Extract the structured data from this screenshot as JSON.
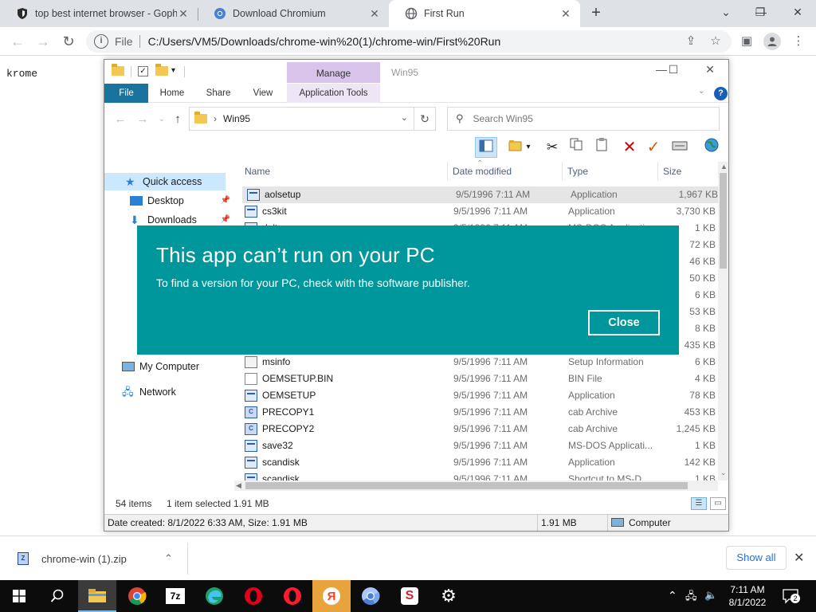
{
  "browser": {
    "tabs": [
      {
        "title": "top best internet browser - Gopher",
        "active": false
      },
      {
        "title": "Download Chromium",
        "active": false
      },
      {
        "title": "First Run",
        "active": true
      }
    ],
    "omnibox": {
      "scheme": "File",
      "url": "C:/Users/VM5/Downloads/chrome-win%20(1)/chrome-win/First%20Run"
    }
  },
  "page": {
    "text": "krome"
  },
  "explorer": {
    "window_title": "Win95",
    "contextual_tab_group": "Manage",
    "ribbon_tabs": [
      "File",
      "Home",
      "Share",
      "View",
      "Application Tools"
    ],
    "address": {
      "current": "Win95"
    },
    "search": {
      "placeholder": "Search Win95"
    },
    "nav_items": {
      "quick_access": "Quick access",
      "desktop": "Desktop",
      "downloads": "Downloads",
      "my_computer": "My Computer",
      "network": "Network"
    },
    "columns": {
      "name": "Name",
      "date": "Date modified",
      "type": "Type",
      "size": "Size"
    },
    "files": [
      {
        "name": "aolsetup",
        "date": "9/5/1996 7:11 AM",
        "type": "Application",
        "size": "1,967 KB",
        "icon": "app-icon",
        "selected": true
      },
      {
        "name": "cs3kit",
        "date": "9/5/1996 7:11 AM",
        "type": "Application",
        "size": "3,730 KB",
        "icon": "app-icon"
      },
      {
        "name": "deltree",
        "date": "9/5/1996 7:11 AM",
        "type": "MS-DOS Application",
        "size": "1 KB",
        "icon": "app-icon"
      },
      {
        "name": "",
        "date": "",
        "type": "",
        "size": "72 KB",
        "icon": ""
      },
      {
        "name": "",
        "date": "",
        "type": "",
        "size": "46 KB",
        "icon": ""
      },
      {
        "name": "",
        "date": "",
        "type": "",
        "size": "50 KB",
        "icon": ""
      },
      {
        "name": "",
        "date": "",
        "type": "",
        "size": "6 KB",
        "icon": ""
      },
      {
        "name": "",
        "date": "",
        "type": "",
        "size": "53 KB",
        "icon": ""
      },
      {
        "name": "",
        "date": "",
        "type": "",
        "size": "8 KB",
        "icon": ""
      },
      {
        "name": "",
        "date": "",
        "type": "",
        "size": "435 KB",
        "icon": ""
      },
      {
        "name": "msinfo",
        "date": "9/5/1996 7:11 AM",
        "type": "Setup Information",
        "size": "6 KB",
        "icon": "info-icon"
      },
      {
        "name": "OEMSETUP.BIN",
        "date": "9/5/1996 7:11 AM",
        "type": "BIN File",
        "size": "4 KB",
        "icon": "doc-icon"
      },
      {
        "name": "OEMSETUP",
        "date": "9/5/1996 7:11 AM",
        "type": "Application",
        "size": "78 KB",
        "icon": "app-icon"
      },
      {
        "name": "PRECOPY1",
        "date": "9/5/1996 7:11 AM",
        "type": "cab Archive",
        "size": "453 KB",
        "icon": "cab-icon"
      },
      {
        "name": "PRECOPY2",
        "date": "9/5/1996 7:11 AM",
        "type": "cab Archive",
        "size": "1,245 KB",
        "icon": "cab-icon"
      },
      {
        "name": "save32",
        "date": "9/5/1996 7:11 AM",
        "type": "MS-DOS Applicati...",
        "size": "1 KB",
        "icon": "app-icon"
      },
      {
        "name": "scandisk",
        "date": "9/5/1996 7:11 AM",
        "type": "Application",
        "size": "142 KB",
        "icon": "app-icon"
      },
      {
        "name": "scandisk",
        "date": "9/5/1996 7:11 AM",
        "type": "Shortcut to MS-D...",
        "size": "1 KB",
        "icon": "app-icon"
      }
    ],
    "status": {
      "count": "54 items",
      "selection": "1 item selected",
      "size": "1.91 MB"
    },
    "w95status": {
      "info": "Date created: 8/1/2022 6:33 AM, Size: 1.91 MB",
      "size": "1.91 MB",
      "location": "Computer"
    }
  },
  "dialog": {
    "title": "This app can’t run on your PC",
    "message": "To find a version for your PC, check with the software publisher.",
    "close_label": "Close"
  },
  "download_shelf": {
    "file": "chrome-win (1).zip",
    "show_all": "Show all"
  },
  "taskbar": {
    "apps": [
      "file-explorer",
      "chrome",
      "7zip",
      "edge",
      "opera",
      "opera-gx",
      "yandex",
      "chromium",
      "app-s",
      "settings"
    ],
    "time": "7:11 AM",
    "date": "8/1/2022",
    "notifications": "2"
  },
  "colors": {
    "dialog_bg": "#00979c",
    "ribbon_file": "#19739f",
    "manage_band": "#d9c4ec"
  }
}
